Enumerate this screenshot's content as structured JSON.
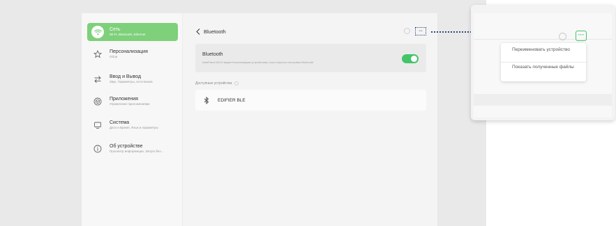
{
  "colors": {
    "accent": "#43c46a",
    "sidebar_active": "#7ed07a",
    "annotation": "#27487a"
  },
  "sidebar": {
    "items": [
      {
        "icon": "wifi-icon",
        "title": "Сеть",
        "subtitle": "Wi-Fi, Bluetooth, Ethernet",
        "active": true
      },
      {
        "icon": "star-icon",
        "title": "Персонализация",
        "subtitle": "Обои",
        "active": false
      },
      {
        "icon": "swap-arrows-icon",
        "title": "Ввод и Вывод",
        "subtitle": "Звук, Параметры, источников",
        "active": false
      },
      {
        "icon": "cube-icon",
        "title": "Приложения",
        "subtitle": "Управление приложениями",
        "active": false
      },
      {
        "icon": "monitor-icon",
        "title": "Система",
        "subtitle": "Дата и Время, Язык и параметры",
        "active": false
      },
      {
        "icon": "info-icon",
        "title": "Об устройстве",
        "subtitle": "Просмотр информации, Запуск без...",
        "active": false
      }
    ]
  },
  "main": {
    "back_label": "Bluetooth",
    "bluetooth_card": {
      "title": "Bluetooth",
      "description": "NobiPanel-NX10 виден близлежащим устройствам, пока открыты настройки Bluetooth.",
      "toggle_on": true
    },
    "available_label": "Доступные устройства",
    "devices": [
      "EDIFIER BLE"
    ]
  },
  "zoom_popup": {
    "menu": [
      "Переименовать устройство",
      "Показать полученные файлы"
    ]
  }
}
